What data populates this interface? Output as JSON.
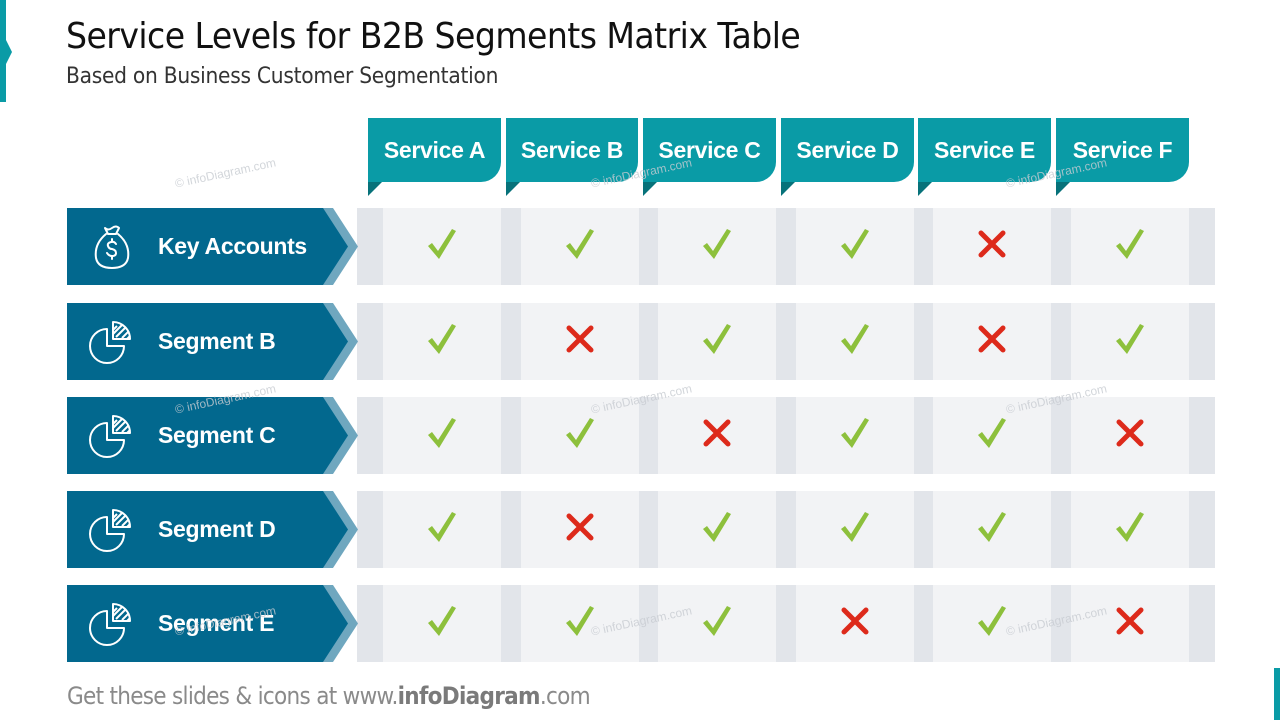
{
  "slide": {
    "title": "Service Levels for B2B Segments Matrix Table",
    "subtitle": "Based on Business Customer Segmentation"
  },
  "colors": {
    "accent_teal": "#0a9ba6",
    "segment_blue": "#02688e",
    "check_green": "#8dc03c",
    "cross_red": "#dd2a1b",
    "cell_bg": "#f2f3f5",
    "stripe_bg": "#e2e5ea"
  },
  "services": [
    "Service A",
    "Service B",
    "Service C",
    "Service D",
    "Service E",
    "Service F"
  ],
  "segments": [
    {
      "label": "Key Accounts",
      "icon": "money-bag-icon",
      "values": [
        "check",
        "check",
        "check",
        "check",
        "cross",
        "check"
      ]
    },
    {
      "label": "Segment B",
      "icon": "pie-chart-icon",
      "values": [
        "check",
        "cross",
        "check",
        "check",
        "cross",
        "check"
      ]
    },
    {
      "label": "Segment C",
      "icon": "pie-chart-icon",
      "values": [
        "check",
        "check",
        "cross",
        "check",
        "check",
        "cross"
      ]
    },
    {
      "label": "Segment D",
      "icon": "pie-chart-icon",
      "values": [
        "check",
        "cross",
        "check",
        "check",
        "check",
        "check"
      ]
    },
    {
      "label": "Segment E",
      "icon": "pie-chart-icon",
      "values": [
        "check",
        "check",
        "check",
        "cross",
        "check",
        "cross"
      ]
    }
  ],
  "watermark": "© infoDiagram.com",
  "footer": {
    "prefix": "Get these slides & icons at www.",
    "brand": "infoDiagram",
    "suffix": ".com"
  }
}
